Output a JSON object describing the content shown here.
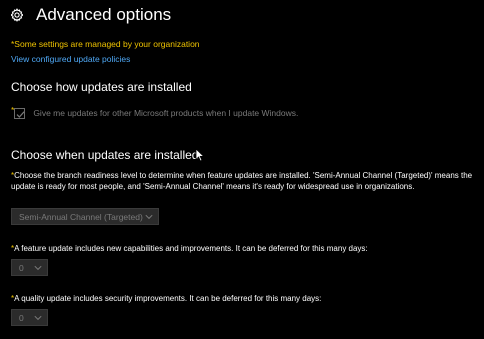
{
  "header": {
    "title": "Advanced options",
    "icon": "gear-icon"
  },
  "notices": {
    "managed": "*Some settings are managed by your organization",
    "policies_link": "View configured update policies"
  },
  "install_section": {
    "title": "Choose how updates are installed",
    "checkbox": {
      "asterisk": "*",
      "label": "Give me updates for other Microsoft products when I update Windows.",
      "checked": true,
      "disabled": true
    }
  },
  "when_section": {
    "title": "Choose when updates are installed",
    "branch": {
      "asterisk": "*",
      "description": "Choose the branch readiness level to determine when feature updates are installed. 'Semi-Annual Channel (Targeted)' means the update is ready for most people, and 'Semi-Annual Channel' means it's ready for widespread use in organizations.",
      "selected": "Semi-Annual Channel (Targeted)"
    },
    "feature_deferral": {
      "asterisk": "*",
      "description": "A feature update includes new capabilities and improvements. It can be deferred for this many days:",
      "selected": "0"
    },
    "quality_deferral": {
      "asterisk": "*",
      "description": "A quality update includes security improvements. It can be deferred for this many days:",
      "selected": "0"
    }
  },
  "colors": {
    "background": "#000000",
    "warning": "#f0c400",
    "link": "#4fa8f5",
    "disabled_text": "#7a7a7a"
  }
}
